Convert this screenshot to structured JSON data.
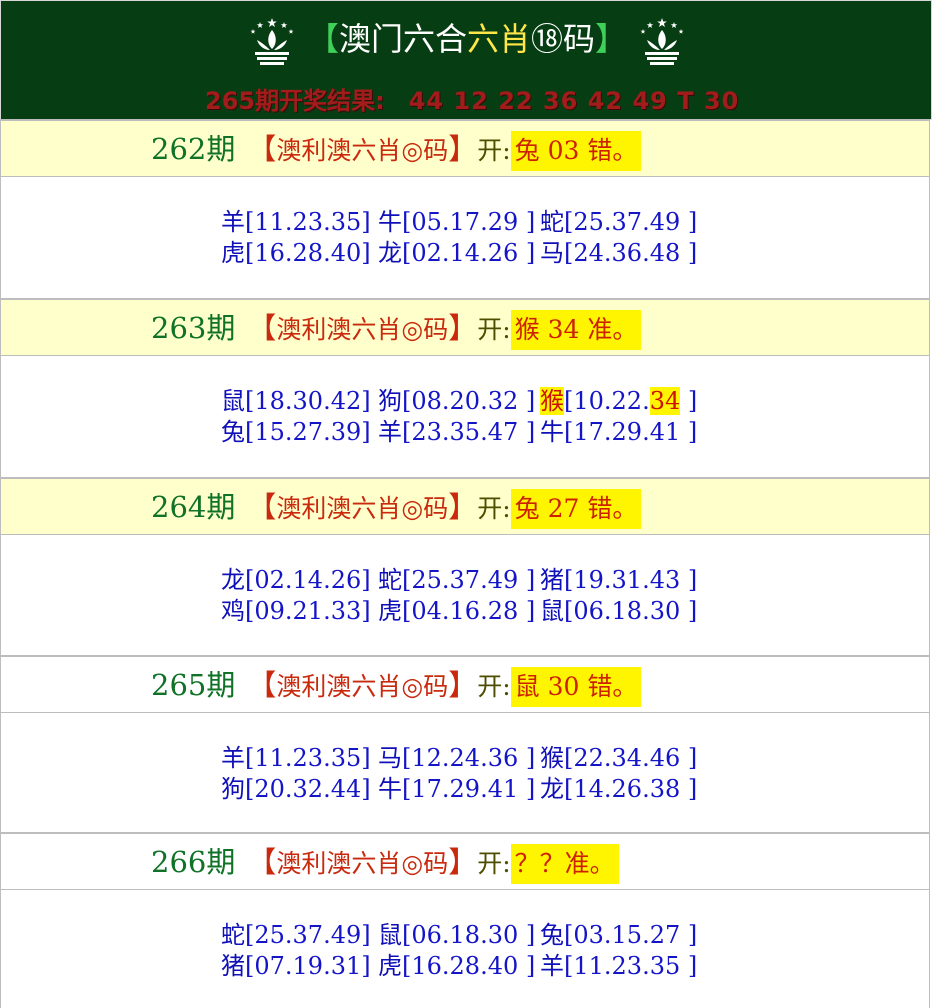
{
  "header": {
    "title_open": "【",
    "title_part1": "澳门六合",
    "title_part2": "六肖",
    "title_part3": "⑱码",
    "title_close": "】",
    "result_label": "265期开奖结果:",
    "result_numbers": "44 12 22 36 42 49 T 30"
  },
  "periods": [
    {
      "num": "262期",
      "tag_open": "【",
      "tag": "澳利澳六肖◎码",
      "tag_close": "】",
      "kai": "开:",
      "result": "兔 03 错。",
      "header_bg": "yellow",
      "rows": [
        [
          {
            "zodiac": "羊",
            "nums": "[11.23.35]"
          },
          {
            "zodiac": "牛",
            "nums": "[05.17.29 ]"
          },
          {
            "zodiac": "蛇",
            "nums": "[25.37.49 ]"
          }
        ],
        [
          {
            "zodiac": "虎",
            "nums": "[16.28.40]"
          },
          {
            "zodiac": "龙",
            "nums": "[02.14.26 ]"
          },
          {
            "zodiac": "马",
            "nums": "[24.36.48 ]"
          }
        ]
      ]
    },
    {
      "num": "263期",
      "tag_open": "【",
      "tag": "澳利澳六肖◎码",
      "tag_close": "】",
      "kai": "开:",
      "result": "猴 34 准。",
      "header_bg": "yellow",
      "rows": [
        [
          {
            "zodiac": "鼠",
            "nums": "[18.30.42]"
          },
          {
            "zodiac": "狗",
            "nums": "[08.20.32 ]"
          },
          {
            "zodiac": "猴",
            "nums_a": "[10.22.",
            "nums_hit": "34",
            "nums_b": " ]",
            "hit": true
          }
        ],
        [
          {
            "zodiac": "兔",
            "nums": "[15.27.39]"
          },
          {
            "zodiac": "羊",
            "nums": "[23.35.47 ]"
          },
          {
            "zodiac": "牛",
            "nums": "[17.29.41 ]"
          }
        ]
      ]
    },
    {
      "num": "264期",
      "tag_open": "【",
      "tag": "澳利澳六肖◎码",
      "tag_close": "】",
      "kai": "开:",
      "result": "兔 27 错。",
      "header_bg": "yellow",
      "rows": [
        [
          {
            "zodiac": "龙",
            "nums": "[02.14.26]"
          },
          {
            "zodiac": "蛇",
            "nums": "[25.37.49 ]"
          },
          {
            "zodiac": "猪",
            "nums": "[19.31.43 ]"
          }
        ],
        [
          {
            "zodiac": "鸡",
            "nums": "[09.21.33]"
          },
          {
            "zodiac": "虎",
            "nums": "[04.16.28 ]"
          },
          {
            "zodiac": "鼠",
            "nums": "[06.18.30 ]"
          }
        ]
      ]
    },
    {
      "num": "265期",
      "tag_open": "【",
      "tag": "澳利澳六肖◎码",
      "tag_close": "】",
      "kai": "开:",
      "result": "鼠 30 错。",
      "header_bg": "white",
      "rows": [
        [
          {
            "zodiac": "羊",
            "nums": "[11.23.35]"
          },
          {
            "zodiac": "马",
            "nums": "[12.24.36 ]"
          },
          {
            "zodiac": "猴",
            "nums": "[22.34.46 ]"
          }
        ],
        [
          {
            "zodiac": "狗",
            "nums": "[20.32.44]"
          },
          {
            "zodiac": "牛",
            "nums": "[17.29.41 ]"
          },
          {
            "zodiac": "龙",
            "nums": "[14.26.38 ]"
          }
        ]
      ]
    },
    {
      "num": "266期",
      "tag_open": "【",
      "tag": "澳利澳六肖◎码",
      "tag_close": "】",
      "kai": "开:",
      "result": "？？准。",
      "header_bg": "white",
      "rows": [
        [
          {
            "zodiac": "蛇",
            "nums": "[25.37.49]"
          },
          {
            "zodiac": "鼠",
            "nums": "[06.18.30 ]"
          },
          {
            "zodiac": "兔",
            "nums": "[03.15.27 ]"
          }
        ],
        [
          {
            "zodiac": "猪",
            "nums": "[07.19.31]"
          },
          {
            "zodiac": "虎",
            "nums": "[16.28.40 ]"
          },
          {
            "zodiac": "羊",
            "nums": "[11.23.35 ]"
          }
        ]
      ]
    }
  ]
}
